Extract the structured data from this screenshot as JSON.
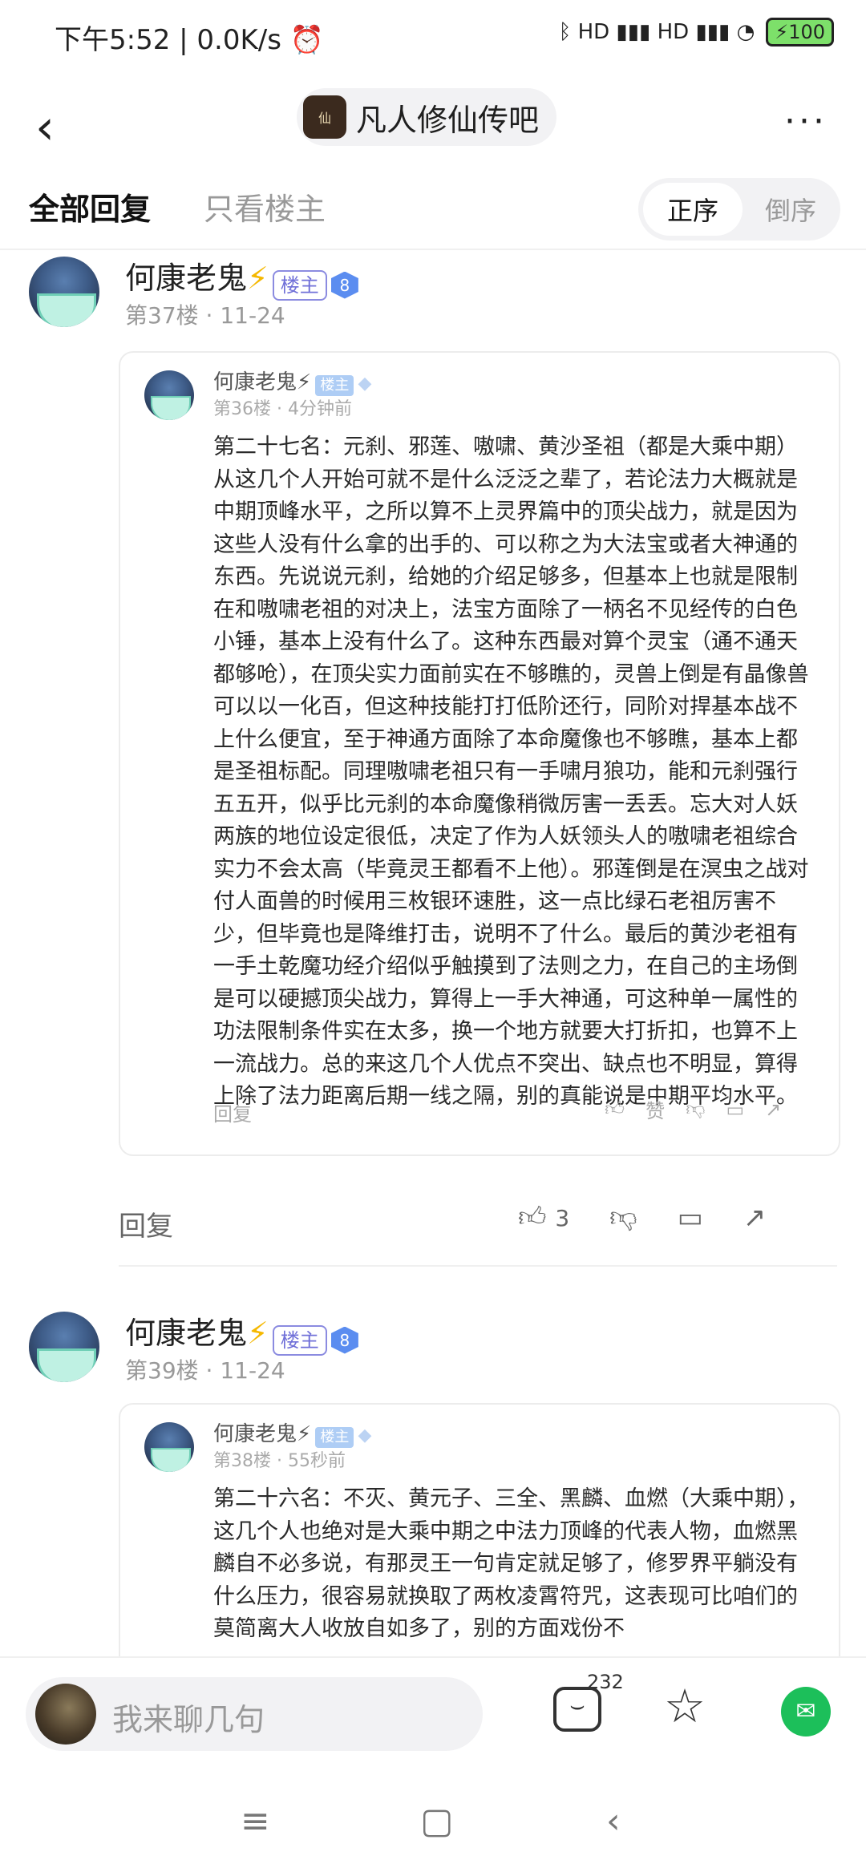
{
  "status": {
    "time": "下午5:52 | 0.0K/s",
    "alarm": "⏰",
    "right_icons": "ᛒ HD ▮▮▮ HD ▮▮▮ ◔",
    "battery": "100"
  },
  "header": {
    "back": "‹",
    "forum_name": "凡人修仙传吧",
    "more": "···"
  },
  "tabs": {
    "all": "全部回复",
    "op_only": "只看楼主",
    "asc": "正序",
    "desc": "倒序"
  },
  "posts": [
    {
      "user": "何康老鬼",
      "bolt": "⚡",
      "op_badge": "楼主",
      "level": "8",
      "floor": "第37楼",
      "date": "11-24",
      "quote": {
        "user": "何康老鬼",
        "bolt": "⚡",
        "op_badge": "楼主",
        "floor": "第36楼",
        "time": "4分钟前",
        "text": "第二十七名：元刹、邪莲、嗷啸、黄沙圣祖（都是大乘中期）从这几个人开始可就不是什么泛泛之辈了，若论法力大概就是中期顶峰水平，之所以算不上灵界篇中的顶尖战力，就是因为这些人没有什么拿的出手的、可以称之为大法宝或者大神通的东西。先说说元刹，给她的介绍足够多，但基本上也就是限制在和嗷啸老祖的对决上，法宝方面除了一柄名不见经传的白色小锤，基本上没有什么了。这种东西最对算个灵宝（通不通天都够呛），在顶尖实力面前实在不够瞧的，灵兽上倒是有晶像兽可以以一化百，但这种技能打打低阶还行，同阶对捍基本战不上什么便宜，至于神通方面除了本命魔像也不够瞧，基本上都是圣祖标配。同理嗷啸老祖只有一手啸月狼功，能和元刹强行五五开，似乎比元刹的本命魔像稍微厉害一丢丢。忘大对人妖两族的地位设定很低，决定了作为人妖领头人的嗷啸老祖综合实力不会太高（毕竟灵王都看不上他）。邪莲倒是在溟虫之战对付人面兽的时候用三枚银环速胜，这一点比绿石老祖厉害不少，但毕竟也是降维打击，说明不了什么。最后的黄沙老祖有一手土乾魔功经介绍似乎触摸到了法则之力，在自己的主场倒是可以硬撼顶尖战力，算得上一手大神通，可这种单一属性的功法限制条件实在太多，换一个地方就要大打折扣，也算不上一流战力。总的来这几个人优点不突出、缺点也不明显，算得上除了法力距离后期一线之隔，别的真能说是中期平均水平。",
        "reply": "回复",
        "like": "赞"
      },
      "reply": "回复",
      "likes": "3"
    },
    {
      "user": "何康老鬼",
      "bolt": "⚡",
      "op_badge": "楼主",
      "level": "8",
      "floor": "第39楼",
      "date": "11-24",
      "quote": {
        "user": "何康老鬼",
        "bolt": "⚡",
        "op_badge": "楼主",
        "floor": "第38楼",
        "time": "55秒前",
        "text": "第二十六名：不灭、黄元子、三全、黑麟、血燃（大乘中期），这几个人也绝对是大乘中期之中法力顶峰的代表人物，血燃黑麟自不必多说，有那灵王一句肯定就足够了，修罗界平躺没有什么压力，很容易就换取了两枚凌霄符咒，这表现可比咱们的莫简离大人收放自如多了，别的方面戏份不"
      }
    }
  ],
  "bottom": {
    "placeholder": "我来聊几句",
    "comment_count": "232"
  }
}
